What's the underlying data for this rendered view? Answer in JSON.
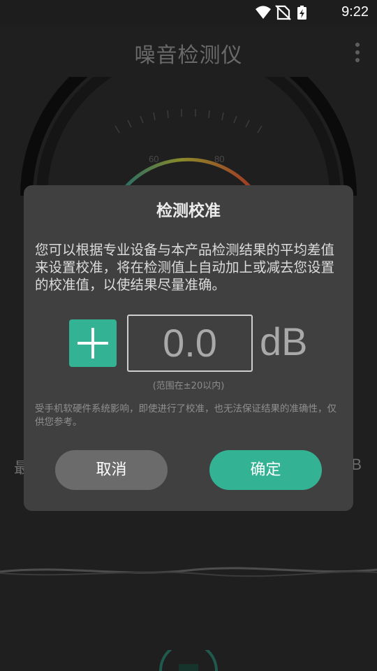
{
  "status_bar": {
    "time": "9:22",
    "icons": [
      "wifi-icon",
      "no-sim-icon",
      "battery-charging-icon"
    ]
  },
  "app": {
    "title": "噪音检测仪",
    "gauge_ticks": [
      "60",
      "80"
    ],
    "left_partial": "最",
    "right_partial": "B"
  },
  "dialog": {
    "title": "检测校准",
    "description": "您可以根据专业设备与本产品检测结果的平均差值来设置校准，将在检测值上自动加上或减去您设置的校准值，以使结果尽量准确。",
    "value": "0.0",
    "unit": "dB",
    "range_hint": "(范围在±20以内)",
    "note": "受手机软硬件系统影响，即使进行了校准，也无法保证结果的准确性，仅供您参考。",
    "cancel_label": "取消",
    "confirm_label": "确定"
  },
  "colors": {
    "accent": "#34b394",
    "dialog_bg": "#404040",
    "screen_bg": "#1f1f1f",
    "cancel_bg": "#6b6b6b"
  }
}
